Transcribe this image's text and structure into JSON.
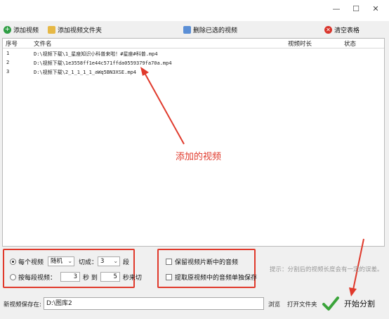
{
  "window": {
    "minimize": "—",
    "maximize": "☐",
    "close": "✕"
  },
  "toolbar": {
    "add_video": "添加视频",
    "add_folder": "添加视频文件夹",
    "delete_selected": "删除已选的视频",
    "clear_table": "清空表格"
  },
  "table": {
    "columns": {
      "index": "序号",
      "filename": "文件名",
      "duration": "视频时长",
      "status": "状态"
    },
    "rows": [
      {
        "index": "1",
        "filename": "D:\\视频下载\\1_星座知识小科普来啦！#星座#科普.mp4",
        "duration": "",
        "status": ""
      },
      {
        "index": "2",
        "filename": "D:\\视频下载\\1e3558ff1e44c571ffda0559379fa70a.mp4",
        "duration": "",
        "status": ""
      },
      {
        "index": "3",
        "filename": "D:\\视频下载\\2_1_1_1_1_aWq5BN3XSE.mp4",
        "duration": "",
        "status": ""
      }
    ]
  },
  "annotation": "添加的视频",
  "options": {
    "per_video_label": "每个视频",
    "mode_value": "随机",
    "cut_into_label": "切成：",
    "segments_value": "3",
    "segments_unit": "段",
    "by_seconds_label": "按每段视频：",
    "sec_from": "3",
    "sec_unit_from": "秒 到",
    "sec_to": "5",
    "sec_unit_to": "秒来切",
    "keep_audio_label": "保留视频片断中的音频",
    "extract_audio_label": "提取原视频中的音频单独保存"
  },
  "hint": "提示：分割后的视频长度会有一定的误差。",
  "save": {
    "label": "新视频保存在:",
    "path": "D:\\图库2",
    "browse": "浏览",
    "open_folder": "打开文件夹"
  },
  "start_button": "开始分割",
  "colors": {
    "annotation_red": "#e0392b",
    "start_check_green": "#3aa43a"
  }
}
